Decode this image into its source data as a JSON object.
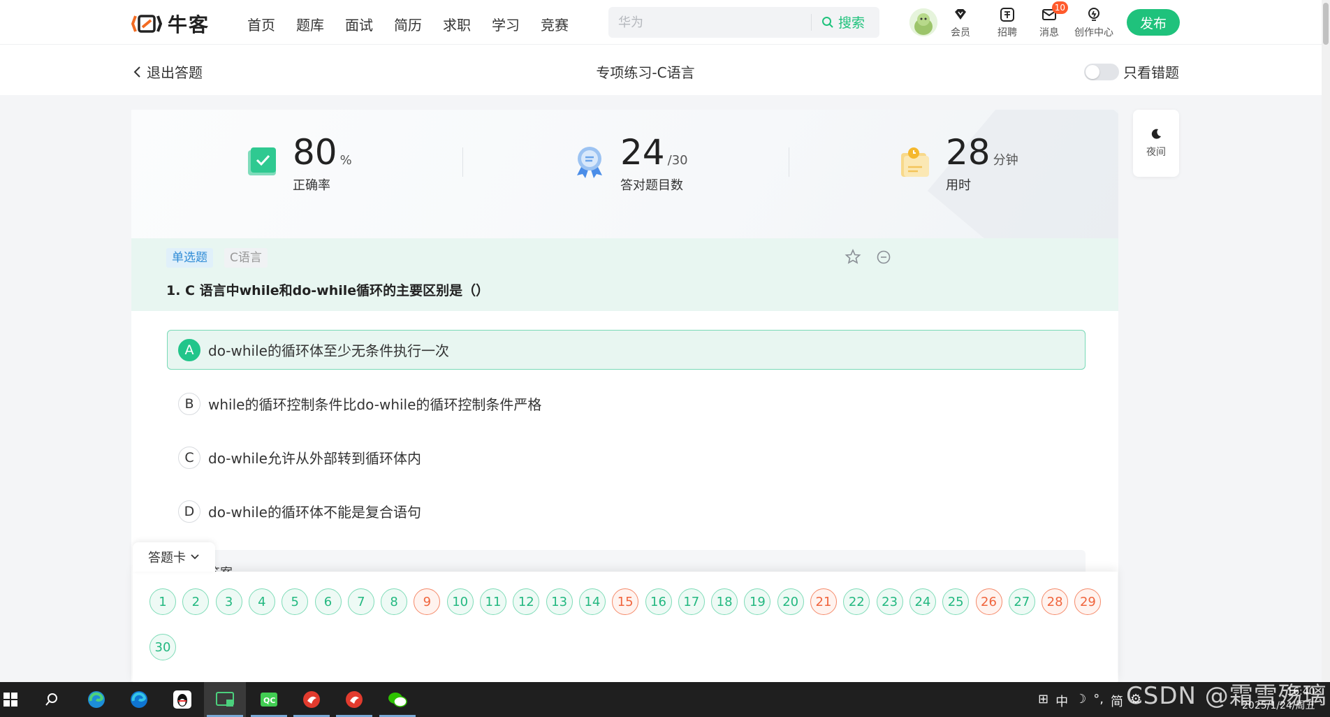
{
  "brand": {
    "name": "牛客"
  },
  "nav": {
    "items": [
      "首页",
      "题库",
      "面试",
      "简历",
      "求职",
      "学习",
      "竞赛"
    ]
  },
  "search": {
    "placeholder": "华为",
    "button_label": "搜索"
  },
  "toolbar": {
    "member": "会员",
    "recruit": "招聘",
    "messages": "消息",
    "messages_badge": "10",
    "creator": "创作中心",
    "publish": "发布"
  },
  "subheader": {
    "back_label": "退出答题",
    "title": "专项练习-C语言",
    "only_wrong_label": "只看错题"
  },
  "stats": {
    "accuracy": {
      "value": "80",
      "unit": "%",
      "label": "正确率"
    },
    "correct": {
      "value": "24",
      "unit": "/30",
      "label": "答对题目数"
    },
    "time": {
      "value": "28",
      "unit": "分钟",
      "label": "用时"
    }
  },
  "question": {
    "type_tag": "单选题",
    "lang_tag": "C语言",
    "title": "1. C 语言中while和do-while循环的主要区别是（）",
    "options": [
      {
        "letter": "A",
        "text": "do-while的循环体至少无条件执行一次",
        "selected": true
      },
      {
        "letter": "B",
        "text": "while的循环控制条件比do-while的循环控制条件严格",
        "selected": false
      },
      {
        "letter": "C",
        "text": "do-while允许从外部转到循环体内",
        "selected": false
      },
      {
        "letter": "D",
        "text": "do-while的循环体不能是复合语句",
        "selected": false
      }
    ],
    "answer_peek": "答案"
  },
  "answer_sheet": {
    "tab_label": "答题卡",
    "numbers": [
      {
        "n": "1",
        "wrong": false
      },
      {
        "n": "2",
        "wrong": false
      },
      {
        "n": "3",
        "wrong": false
      },
      {
        "n": "4",
        "wrong": false
      },
      {
        "n": "5",
        "wrong": false
      },
      {
        "n": "6",
        "wrong": false
      },
      {
        "n": "7",
        "wrong": false
      },
      {
        "n": "8",
        "wrong": false
      },
      {
        "n": "9",
        "wrong": true
      },
      {
        "n": "10",
        "wrong": false
      },
      {
        "n": "11",
        "wrong": false
      },
      {
        "n": "12",
        "wrong": false
      },
      {
        "n": "13",
        "wrong": false
      },
      {
        "n": "14",
        "wrong": false
      },
      {
        "n": "15",
        "wrong": true
      },
      {
        "n": "16",
        "wrong": false
      },
      {
        "n": "17",
        "wrong": false
      },
      {
        "n": "18",
        "wrong": false
      },
      {
        "n": "19",
        "wrong": false
      },
      {
        "n": "20",
        "wrong": false
      },
      {
        "n": "21",
        "wrong": true
      },
      {
        "n": "22",
        "wrong": false
      },
      {
        "n": "23",
        "wrong": false
      },
      {
        "n": "24",
        "wrong": false
      },
      {
        "n": "25",
        "wrong": false
      },
      {
        "n": "26",
        "wrong": true
      },
      {
        "n": "27",
        "wrong": false
      },
      {
        "n": "28",
        "wrong": true
      },
      {
        "n": "29",
        "wrong": true
      },
      {
        "n": "30",
        "wrong": false
      }
    ]
  },
  "night_mode": {
    "label": "夜间"
  },
  "taskbar": {
    "tray_text": [
      "中",
      "简"
    ],
    "clock_time": "16:40",
    "clock_date": "2025/1/24/周五"
  },
  "watermark": "CSDN @霜雪殇璃",
  "colors": {
    "accent": "#1fc27c",
    "wrong": "#f0643c",
    "correct": "#23b880"
  }
}
